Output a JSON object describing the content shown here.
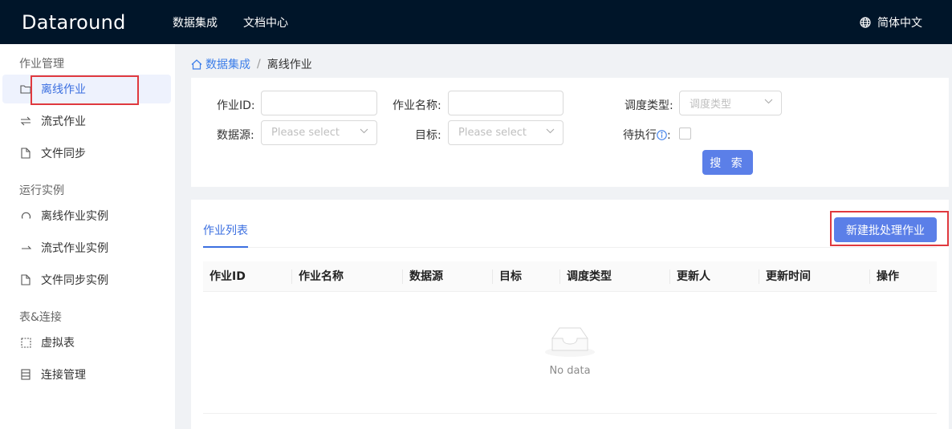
{
  "header": {
    "logo": "Dataround",
    "nav": [
      "数据集成",
      "文档中心"
    ],
    "language": "简体中文"
  },
  "sidebar": {
    "groups": [
      {
        "title": "作业管理",
        "items": [
          {
            "label": "离线作业",
            "icon": "folder-icon",
            "active": true
          },
          {
            "label": "流式作业",
            "icon": "swap-icon"
          },
          {
            "label": "文件同步",
            "icon": "file-icon"
          }
        ]
      },
      {
        "title": "运行实例",
        "items": [
          {
            "label": "离线作业实例",
            "icon": "refresh-icon"
          },
          {
            "label": "流式作业实例",
            "icon": "arrow-right-icon"
          },
          {
            "label": "文件同步实例",
            "icon": "file-icon"
          }
        ]
      },
      {
        "title": "表&连接",
        "items": [
          {
            "label": "虚拟表",
            "icon": "dashed-box-icon"
          },
          {
            "label": "连接管理",
            "icon": "database-icon"
          }
        ]
      }
    ]
  },
  "breadcrumb": {
    "home": "数据集成",
    "separator": "/",
    "current": "离线作业"
  },
  "filter": {
    "job_id_label": "作业ID:",
    "job_id_value": "",
    "job_name_label": "作业名称:",
    "job_name_value": "",
    "schedule_type_label": "调度类型:",
    "schedule_type_placeholder": "调度类型",
    "datasource_label": "数据源:",
    "datasource_placeholder": "Please select",
    "target_label": "目标:",
    "target_placeholder": "Please select",
    "pending_label": "待执行",
    "pending_colon": ":",
    "search_button": "搜 索"
  },
  "list": {
    "tab": "作业列表",
    "new_button": "新建批处理作业",
    "columns": [
      "作业ID",
      "作业名称",
      "数据源",
      "目标",
      "调度类型",
      "更新人",
      "更新时间",
      "操作"
    ],
    "empty_text": "No data"
  },
  "colors": {
    "primary": "#5b7fe8",
    "header_bg": "#001529",
    "highlight": "#e0393e"
  }
}
